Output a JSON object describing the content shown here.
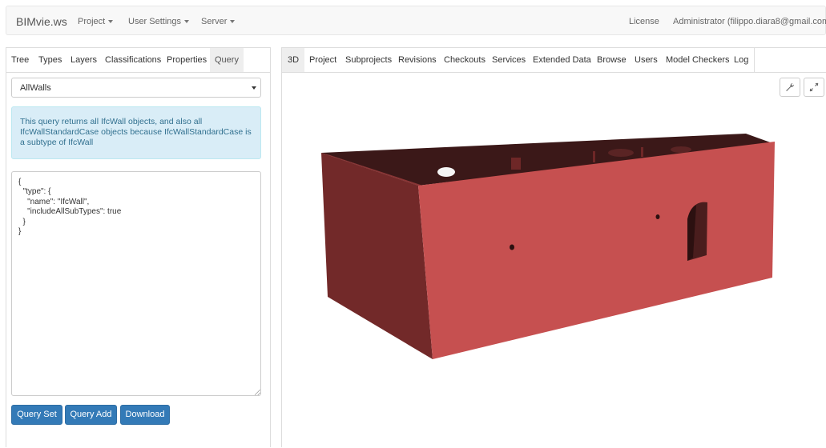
{
  "navbar": {
    "brand": "BIMvie.ws",
    "menus": [
      "Project",
      "User Settings",
      "Server"
    ],
    "license": "License",
    "user": "Administrator (filippo.diara8@gmail.com)"
  },
  "left_panel": {
    "tabs": [
      "Tree",
      "Types",
      "Layers",
      "Classifications",
      "Properties",
      "Query"
    ],
    "active_tab": "Query",
    "query_select": "AllWalls",
    "info": "This query returns all IfcWall objects, and also all IfcWallStandardCase objects because IfcWallStandardCase is a subtype of IfcWall",
    "query_text": "{\n  \"type\": {\n    \"name\": \"IfcWall\",\n    \"includeAllSubTypes\": true\n  }\n}",
    "buttons": {
      "query_set": "Query Set",
      "query_add": "Query Add",
      "download": "Download"
    }
  },
  "right_panel": {
    "tabs": [
      "3D",
      "Project",
      "Subprojects",
      "Revisions",
      "Checkouts",
      "Services",
      "Extended Data",
      "Browse",
      "Users",
      "Model Checkers",
      "Log"
    ],
    "active_tab": "3D",
    "tools": {
      "settings_icon": "wrench-icon",
      "fullscreen_icon": "expand-icon"
    }
  },
  "colors": {
    "model_front": "#c44f4f",
    "model_side": "#712828",
    "model_interior": "#3a1717",
    "alert_bg": "#d9edf7",
    "alert_text": "#31708f",
    "primary": "#337ab7"
  }
}
